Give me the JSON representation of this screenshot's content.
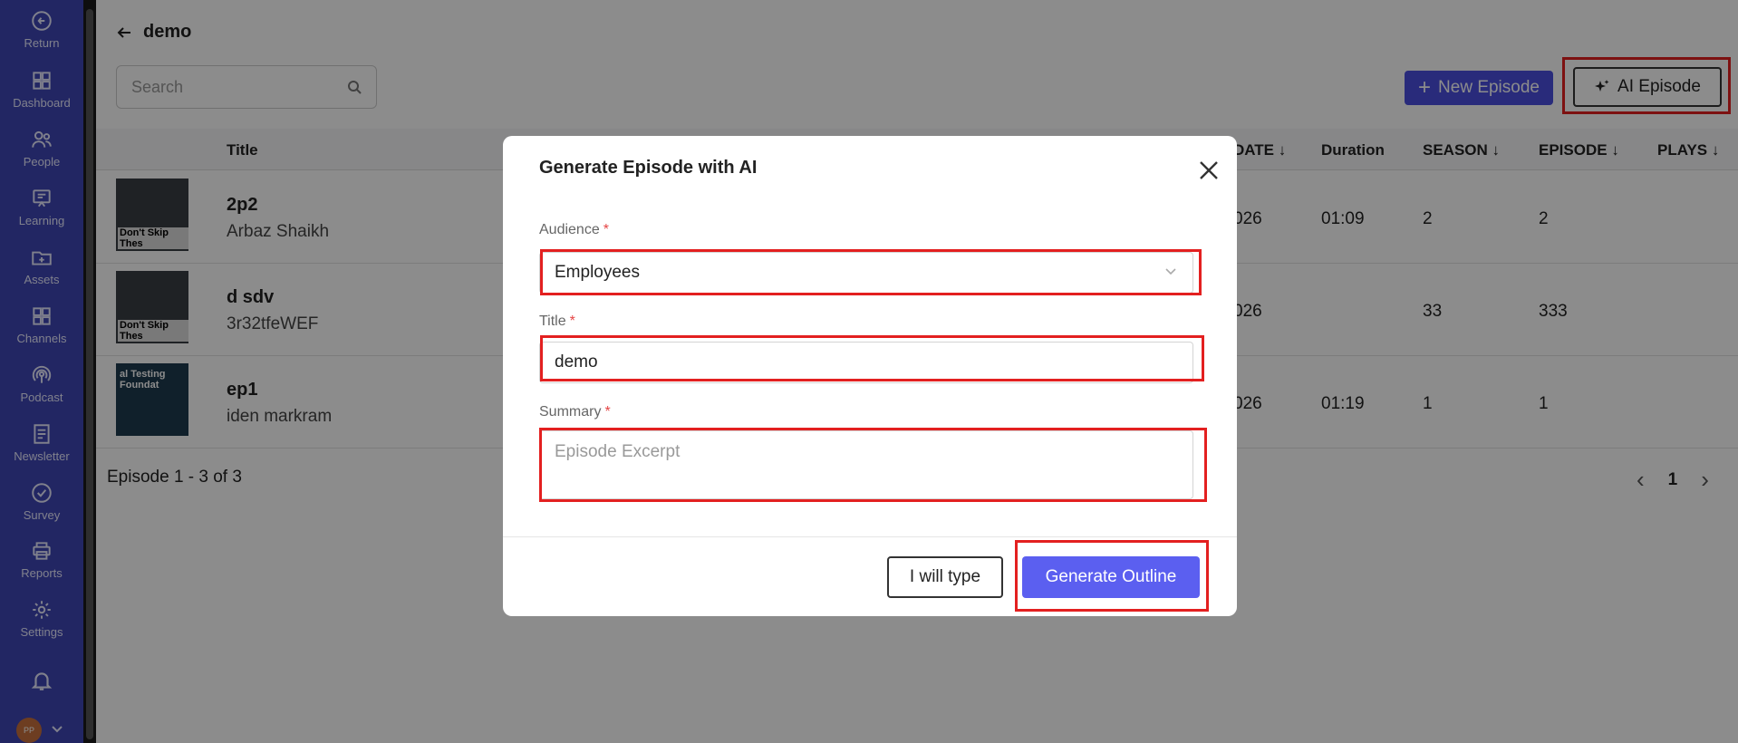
{
  "sidebar": {
    "items": [
      {
        "label": "Return",
        "icon": "return-icon"
      },
      {
        "label": "Dashboard",
        "icon": "dashboard-icon"
      },
      {
        "label": "People",
        "icon": "people-icon"
      },
      {
        "label": "Learning",
        "icon": "learning-icon"
      },
      {
        "label": "Assets",
        "icon": "folder-icon"
      },
      {
        "label": "Channels",
        "icon": "grid-icon"
      },
      {
        "label": "Podcast",
        "icon": "podcast-icon"
      },
      {
        "label": "Newsletter",
        "icon": "newsletter-icon"
      },
      {
        "label": "Survey",
        "icon": "check-circle-icon"
      },
      {
        "label": "Reports",
        "icon": "printer-icon"
      },
      {
        "label": "Settings",
        "icon": "gear-icon"
      }
    ],
    "avatar_initials": "PP"
  },
  "header": {
    "title": "demo",
    "search_placeholder": "Search",
    "new_episode": "New Episode",
    "ai_episode": "AI Episode"
  },
  "table": {
    "columns": [
      "Title",
      "DATE",
      "Duration",
      "SEASON",
      "EPISODE",
      "PLAYS"
    ],
    "rows": [
      {
        "title": "2p2",
        "author": "Arbaz Shaikh",
        "date": "026",
        "duration": "01:09",
        "season": "2",
        "episode": "2",
        "thumb_caption": "Don't Skip Thes"
      },
      {
        "title": "d sdv",
        "author": "3r32tfeWEF",
        "date": "026",
        "duration": "",
        "season": "33",
        "episode": "333",
        "thumb_caption": "Don't Skip Thes"
      },
      {
        "title": "ep1",
        "author": "iden markram",
        "date": "026",
        "duration": "01:19",
        "season": "1",
        "episode": "1",
        "thumb_caption": "al Testing Foundat"
      }
    ],
    "pager_text": "Episode 1 - 3 of 3",
    "page": "1"
  },
  "modal": {
    "title": "Generate Episode with AI",
    "audience_label": "Audience",
    "audience_value": "Employees",
    "title_label": "Title",
    "title_value": "demo",
    "summary_label": "Summary",
    "summary_placeholder": "Episode Excerpt",
    "required_mark": "*",
    "btn_type": "I will type",
    "btn_generate": "Generate Outline"
  }
}
